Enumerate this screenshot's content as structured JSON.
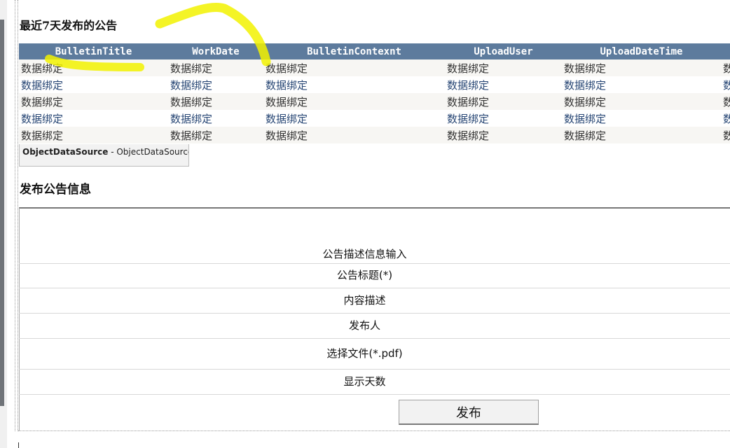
{
  "recent_section": {
    "title": "最近7天发布的公告"
  },
  "grid": {
    "columns": [
      "BulletinTitle",
      "WorkDate",
      "BulletinContexnt",
      "UploadUser",
      "UploadDateTime",
      ""
    ],
    "rows": [
      [
        "数据绑定",
        "数据绑定",
        "数据绑定",
        "数据绑定",
        "数据绑定",
        "数"
      ],
      [
        "数据绑定",
        "数据绑定",
        "数据绑定",
        "数据绑定",
        "数据绑定",
        "数"
      ],
      [
        "数据绑定",
        "数据绑定",
        "数据绑定",
        "数据绑定",
        "数据绑定",
        "数"
      ],
      [
        "数据绑定",
        "数据绑定",
        "数据绑定",
        "数据绑定",
        "数据绑定",
        "数"
      ],
      [
        "数据绑定",
        "数据绑定",
        "数据绑定",
        "数据绑定",
        "数据绑定",
        "数"
      ]
    ]
  },
  "datasource": {
    "type": "ObjectDataSource",
    "separator": " - ",
    "id": "ObjectDataSource1"
  },
  "publish_section": {
    "title": "发布公告信息",
    "caption": "公告描述信息输入",
    "title_field_label": "公告标题(*)",
    "content_field_label": "内容描述",
    "publisher_field_label": "发布人",
    "file_field_label": "选择文件(*.pdf)",
    "days_field_label": "显示天数",
    "submit_label": "发布"
  },
  "colors": {
    "header_bg": "#5d7b9d",
    "alt_row_bg": "#f7f6f3",
    "link_text": "#284775",
    "highlighter": "#f2f200"
  }
}
